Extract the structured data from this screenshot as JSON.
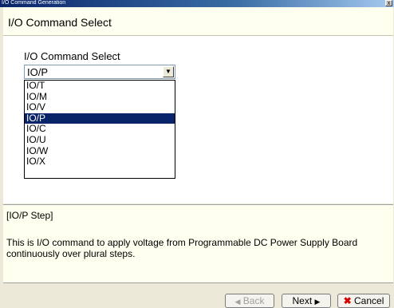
{
  "window": {
    "title": "I/O Command Generation",
    "close_label": "x"
  },
  "header": {
    "title": "I/O Command Select"
  },
  "select": {
    "label": "I/O Command Select",
    "value": "IO/P",
    "options": [
      "IO/T",
      "IO/M",
      "IO/V",
      "IO/P",
      "IO/C",
      "IO/U",
      "IO/W",
      "IO/X"
    ],
    "selected_index": 3
  },
  "description": {
    "title": "[IO/P Step]",
    "body": "This is I/O command to apply voltage from Programmable DC Power Supply Board continuously over plural steps."
  },
  "buttons": {
    "back_label": "Back",
    "next_label": "Next",
    "cancel_label": "Cancel"
  }
}
